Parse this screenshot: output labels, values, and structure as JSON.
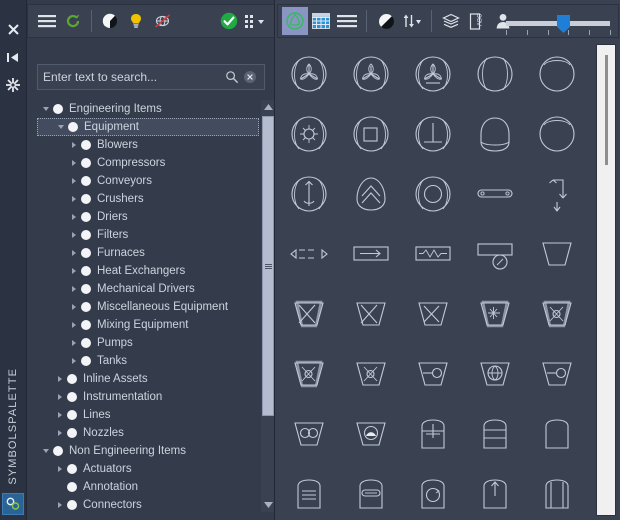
{
  "window": {
    "title": "SYMBOLSPALETTE",
    "background_color": "#3a4252"
  },
  "rail": {
    "vertical_label": "SYMBOLSPALETTE",
    "icons": [
      {
        "name": "close-icon",
        "glyph": "✕"
      },
      {
        "name": "collapse-panel-icon",
        "glyph": "▶|"
      },
      {
        "name": "settings-gear-icon",
        "glyph": "⚙"
      }
    ],
    "bottom_button": {
      "name": "symbols-palette-icon",
      "color": "#2a6496"
    }
  },
  "tree_toolbar": {
    "buttons": [
      {
        "name": "menu-button",
        "label": "Menu",
        "icon": "hamburger-icon"
      },
      {
        "name": "refresh-button",
        "label": "Refresh",
        "icon": "refresh-icon",
        "color": "#5aa832"
      },
      {
        "name": "contrast-button",
        "label": "Contrast",
        "icon": "half-circle-icon"
      },
      {
        "name": "highlight-button",
        "label": "Highlight",
        "icon": "lightbulb-icon",
        "color": "#f2c200"
      },
      {
        "name": "no-preview-button",
        "label": "No Preview",
        "icon": "globe-crossed-icon"
      },
      {
        "name": "apply-button",
        "label": "Apply",
        "icon": "check-circle-icon",
        "color": "#1faa44"
      },
      {
        "name": "grid-options-button",
        "label": "Grid Options",
        "icon": "grid-dots-icon"
      }
    ]
  },
  "search": {
    "placeholder": "Enter text to search...",
    "value": "",
    "search_icon": "magnifier-icon",
    "clear_icon": "clear-circle-icon"
  },
  "tree": {
    "selected": "Equipment",
    "nodes": [
      {
        "label": "Engineering Items",
        "depth": 0,
        "expanded": true,
        "has_children": true
      },
      {
        "label": "Equipment",
        "depth": 1,
        "expanded": true,
        "has_children": true,
        "selected": true
      },
      {
        "label": "Blowers",
        "depth": 2,
        "expanded": false,
        "has_children": true
      },
      {
        "label": "Compressors",
        "depth": 2,
        "expanded": false,
        "has_children": true
      },
      {
        "label": "Conveyors",
        "depth": 2,
        "expanded": false,
        "has_children": true
      },
      {
        "label": "Crushers",
        "depth": 2,
        "expanded": false,
        "has_children": true
      },
      {
        "label": "Driers",
        "depth": 2,
        "expanded": false,
        "has_children": true
      },
      {
        "label": "Filters",
        "depth": 2,
        "expanded": false,
        "has_children": true
      },
      {
        "label": "Furnaces",
        "depth": 2,
        "expanded": false,
        "has_children": true
      },
      {
        "label": "Heat Exchangers",
        "depth": 2,
        "expanded": false,
        "has_children": true
      },
      {
        "label": "Mechanical Drivers",
        "depth": 2,
        "expanded": false,
        "has_children": true
      },
      {
        "label": "Miscellaneous Equipment",
        "depth": 2,
        "expanded": false,
        "has_children": true
      },
      {
        "label": "Mixing Equipment",
        "depth": 2,
        "expanded": false,
        "has_children": true
      },
      {
        "label": "Pumps",
        "depth": 2,
        "expanded": false,
        "has_children": true
      },
      {
        "label": "Tanks",
        "depth": 2,
        "expanded": false,
        "has_children": true
      },
      {
        "label": "Inline Assets",
        "depth": 1,
        "expanded": false,
        "has_children": true
      },
      {
        "label": "Instrumentation",
        "depth": 1,
        "expanded": false,
        "has_children": true
      },
      {
        "label": "Lines",
        "depth": 1,
        "expanded": false,
        "has_children": true
      },
      {
        "label": "Nozzles",
        "depth": 1,
        "expanded": false,
        "has_children": true
      },
      {
        "label": "Non Engineering Items",
        "depth": 0,
        "expanded": true,
        "has_children": true
      },
      {
        "label": "Actuators",
        "depth": 1,
        "expanded": false,
        "has_children": true
      },
      {
        "label": "Annotation",
        "depth": 1,
        "expanded": false,
        "has_children": false
      },
      {
        "label": "Connectors",
        "depth": 1,
        "expanded": false,
        "has_children": true
      }
    ]
  },
  "symbol_toolbar": {
    "buttons": [
      {
        "name": "symbol-view-button",
        "label": "Symbol View",
        "icon": "circle-symbol-icon",
        "active": true
      },
      {
        "name": "grid-view-button",
        "label": "Grid View",
        "icon": "table-grid-icon"
      },
      {
        "name": "list-view-button",
        "label": "List View",
        "icon": "list-lines-icon"
      },
      {
        "name": "contrast-button",
        "label": "Contrast",
        "icon": "half-circle-icon"
      },
      {
        "name": "sort-button",
        "label": "Sort",
        "icon": "sort-arrows-icon"
      },
      {
        "name": "layers-button",
        "label": "Layers",
        "icon": "layers-icon"
      },
      {
        "name": "label-button",
        "label": "Labels",
        "icon": "abc-tag-icon"
      },
      {
        "name": "person-button",
        "label": "User",
        "icon": "person-icon"
      }
    ],
    "zoom_slider": {
      "name": "zoom-slider",
      "value": 50,
      "min": 0,
      "max": 100,
      "ticks": 6
    }
  },
  "symbol_grid": {
    "columns": 5,
    "symbols": [
      {
        "name": "blower-fan-circle",
        "shape": "fan-circle-stem"
      },
      {
        "name": "blower-fan-circle-2",
        "shape": "fan-circle"
      },
      {
        "name": "blower-fan-circle-base",
        "shape": "fan-circle-base"
      },
      {
        "name": "centrifugal-circle",
        "shape": "leaf-circle"
      },
      {
        "name": "plain-circle",
        "shape": "plain-circle"
      },
      {
        "name": "rotary-star-circle",
        "shape": "star-circle"
      },
      {
        "name": "square-in-circle",
        "shape": "square-circle"
      },
      {
        "name": "tee-in-circle",
        "shape": "tee-circle"
      },
      {
        "name": "dome-bottom-circle",
        "shape": "dome-circle"
      },
      {
        "name": "blank-circle-2",
        "shape": "plain-circle"
      },
      {
        "name": "updown-arrow-circle",
        "shape": "updownarrow-circle"
      },
      {
        "name": "chevron-up-circle",
        "shape": "chevron-circle"
      },
      {
        "name": "ring-in-circle",
        "shape": "ring-circle"
      },
      {
        "name": "inline-capsule",
        "shape": "capsule"
      },
      {
        "name": "vertical-arrow-line",
        "shape": "arrow-vert"
      },
      {
        "name": "dashed-flow-arrow",
        "shape": "dashed-arrows"
      },
      {
        "name": "box-right-arrow",
        "shape": "box-arrow"
      },
      {
        "name": "box-zigzag",
        "shape": "box-zigzag"
      },
      {
        "name": "box-with-circle",
        "shape": "box-circle"
      },
      {
        "name": "trapezoid-plain",
        "shape": "trap-plain"
      },
      {
        "name": "crusher-x-shadow",
        "shape": "trap-x-shadow"
      },
      {
        "name": "crusher-x",
        "shape": "trap-x"
      },
      {
        "name": "crusher-x-2",
        "shape": "trap-x2"
      },
      {
        "name": "crusher-cross-hatch",
        "shape": "trap-hatch"
      },
      {
        "name": "crusher-hourglass-shadow",
        "shape": "trap-hour-shadow"
      },
      {
        "name": "crusher-hourglass",
        "shape": "trap-hour"
      },
      {
        "name": "crusher-hourglass-2",
        "shape": "trap-hour2"
      },
      {
        "name": "crusher-roll",
        "shape": "trap-roll"
      },
      {
        "name": "crusher-ball-mill",
        "shape": "trap-ball"
      },
      {
        "name": "crusher-roll-2",
        "shape": "trap-roll2"
      },
      {
        "name": "crusher-double-circle",
        "shape": "trap-double"
      },
      {
        "name": "crusher-cone",
        "shape": "trap-cone"
      },
      {
        "name": "drier-tee-box",
        "shape": "round-box-tee"
      },
      {
        "name": "drier-split-box",
        "shape": "round-box-split"
      },
      {
        "name": "drier-plain-box",
        "shape": "round-box-plain"
      },
      {
        "name": "drier-lines-box",
        "shape": "round-box-lines"
      },
      {
        "name": "drier-capsule-box",
        "shape": "round-box-capsule"
      },
      {
        "name": "drier-circle-box",
        "shape": "round-box-circle"
      },
      {
        "name": "drier-arrow-box",
        "shape": "round-box-arrow"
      },
      {
        "name": "drier-column-box",
        "shape": "round-box-col"
      }
    ]
  }
}
